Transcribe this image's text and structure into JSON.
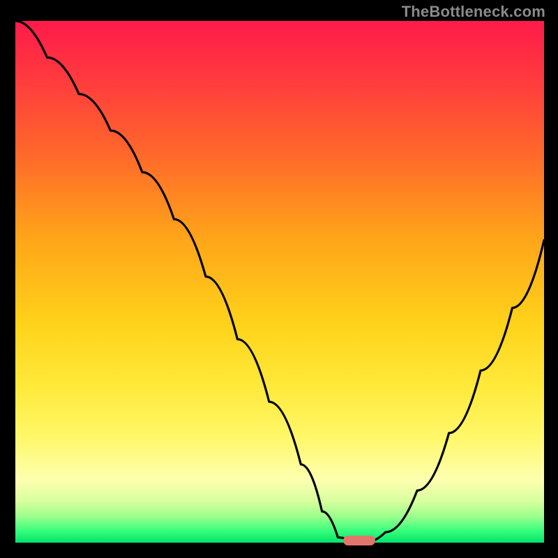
{
  "watermark": "TheBottleneck.com",
  "colors": {
    "frame": "#000000",
    "curve": "#000000",
    "marker": "#e2766d",
    "gradient_stops": [
      "#ff1a4a",
      "#ff3d3d",
      "#ff6a2a",
      "#ffa619",
      "#ffd21a",
      "#ffe93a",
      "#fff86a",
      "#fdffb0",
      "#d8ff9e",
      "#9bff8c",
      "#3fff7e",
      "#00e46a"
    ]
  },
  "chart_data": {
    "type": "line",
    "title": "",
    "xlabel": "",
    "ylabel": "",
    "xlim": [
      0,
      100
    ],
    "ylim": [
      0,
      100
    ],
    "series": [
      {
        "name": "bottleneck-curve",
        "x": [
          0,
          6,
          12,
          18,
          24,
          30,
          36,
          42,
          48,
          54,
          58,
          61,
          64,
          66,
          70,
          76,
          82,
          88,
          94,
          100
        ],
        "y": [
          100,
          93,
          86,
          79,
          71,
          62,
          51,
          39,
          27,
          15,
          6,
          1,
          0,
          0,
          2,
          10,
          21,
          33,
          45,
          58
        ]
      }
    ],
    "marker": {
      "x": 65,
      "y": 0
    },
    "note": "x is horizontal position (0=left,100=right); y is bottleneck % (0=green bottom, 100=red top). Values estimated from pixel positions."
  }
}
